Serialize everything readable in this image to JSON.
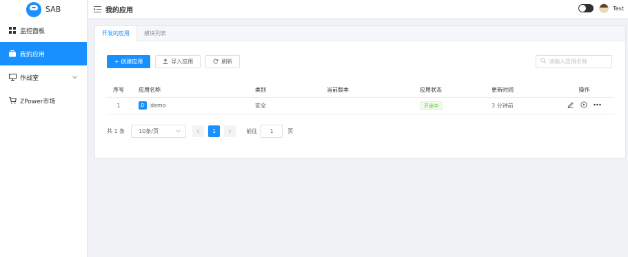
{
  "app": {
    "name": "SAB"
  },
  "sidebar": {
    "items": [
      {
        "label": "监控面板",
        "icon": "dashboard-icon",
        "active": false
      },
      {
        "label": "我的应用",
        "icon": "briefcase-icon",
        "active": true
      },
      {
        "label": "作战室",
        "icon": "monitor-icon",
        "active": false,
        "has_children": true
      },
      {
        "label": "ZPower市场",
        "icon": "cart-icon",
        "active": false
      }
    ]
  },
  "header": {
    "title": "我的应用",
    "user": "Test"
  },
  "tabs": [
    {
      "label": "开发的应用",
      "active": true
    },
    {
      "label": "模块列表",
      "active": false
    }
  ],
  "toolbar": {
    "create_label": "+ 创建应用",
    "import_label": "导入应用",
    "refresh_label": "刷新"
  },
  "search": {
    "placeholder": "请输入应用名称"
  },
  "table": {
    "headers": [
      "序号",
      "应用名称",
      "类别",
      "当前版本",
      "应用状态",
      "更新时间",
      "操作"
    ],
    "rows": [
      {
        "index": "1",
        "badge": "D",
        "name": "demo",
        "category": "安全",
        "version": "",
        "status": "开发中",
        "updated": "3 分钟前"
      }
    ]
  },
  "pagination": {
    "total": "共 1 条",
    "page_size": "10条/页",
    "current_page": "1",
    "goto_label": "前往",
    "goto_value": "1",
    "page_suffix": "页"
  },
  "colors": {
    "primary": "#1890ff",
    "status_green": "#67c23a",
    "background": "#f0f2f5"
  }
}
